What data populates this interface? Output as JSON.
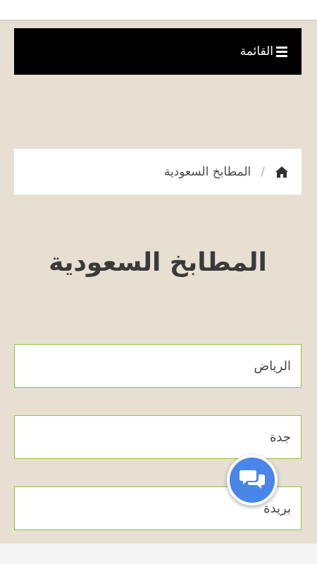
{
  "navbar": {
    "menu_label": "القائمة",
    "menu_icon": "bars-icon",
    "background": "#000000"
  },
  "breadcrumb": {
    "home_icon": "home-icon",
    "separator": "/",
    "current": "المطابخ السعودية"
  },
  "page": {
    "title": "المطابخ السعودية"
  },
  "cities": [
    {
      "label": "الرياض"
    },
    {
      "label": "جدة"
    },
    {
      "label": "بريدة"
    }
  ],
  "chat": {
    "icon": "chat-bubbles-icon",
    "color": "#4a86e8"
  },
  "colors": {
    "page_background": "#e6dfd2",
    "item_border": "#8bc34a"
  }
}
